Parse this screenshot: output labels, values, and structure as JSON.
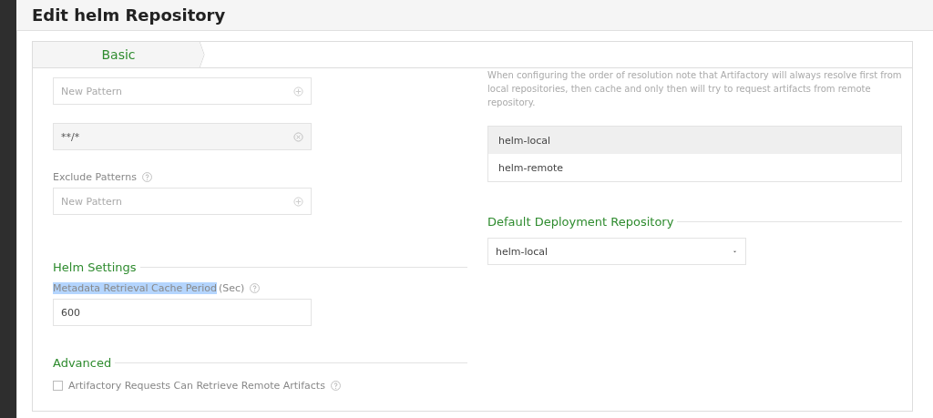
{
  "title": "Edit helm Repository",
  "tabs": [
    {
      "label": "Basic",
      "selected": true
    }
  ],
  "patterns": [
    {
      "kind": "input",
      "placeholder": "New Pattern"
    },
    {
      "kind": "item",
      "value": "**/*"
    }
  ],
  "exclude": {
    "label": "Exclude Patterns",
    "placeholder": "New Pattern"
  },
  "helm_settings": {
    "heading": "Helm Settings",
    "label": "Metadata Retrieval Cache Period",
    "label_highlighted": true,
    "unit": "(Sec)",
    "value": "600"
  },
  "advanced": {
    "heading": "Advanced",
    "checkbox": {
      "label": "Artifactory Requests Can Retrieve Remote Artifacts",
      "checked": false
    }
  },
  "resolution": {
    "note": "When configuring the order of resolution note that Artifactory will always resolve first from local repositories, then cache and only then will try to request artifacts from remote repository.",
    "repositories": [
      {
        "name": "helm-local",
        "selected": true
      },
      {
        "name": "helm-remote",
        "selected": false
      }
    ]
  },
  "default_deployment": {
    "heading": "Default Deployment Repository",
    "value": "helm-local"
  }
}
